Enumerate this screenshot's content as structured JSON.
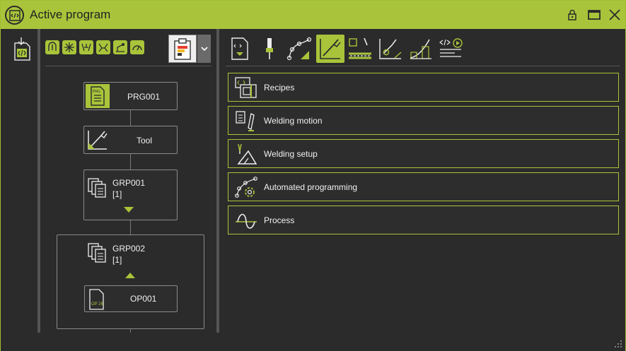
{
  "window": {
    "title": "Active program"
  },
  "tree": {
    "program": {
      "label": "PRG001",
      "icon_text": "PRG"
    },
    "tool": {
      "label": "Tool"
    },
    "group1": {
      "label": "GRP001",
      "count": "[1]"
    },
    "group2": {
      "label": "GRP002",
      "count": "[1]"
    },
    "operation": {
      "label": "OP001",
      "icon_text": "OP 26"
    }
  },
  "menu": {
    "items": [
      {
        "label": "Recipes",
        "icon": "recipe-book-icon"
      },
      {
        "label": "Welding motion",
        "icon": "welding-motion-icon"
      },
      {
        "label": "Welding setup",
        "icon": "welding-setup-icon"
      },
      {
        "label": "Automated programming",
        "icon": "automated-programming-icon"
      },
      {
        "label": "Process",
        "icon": "process-wave-icon"
      }
    ]
  },
  "colors": {
    "accent": "#a9c43a",
    "background": "#2b2b2b",
    "border": "#8a8a8a",
    "text": "#f0f0f0"
  }
}
